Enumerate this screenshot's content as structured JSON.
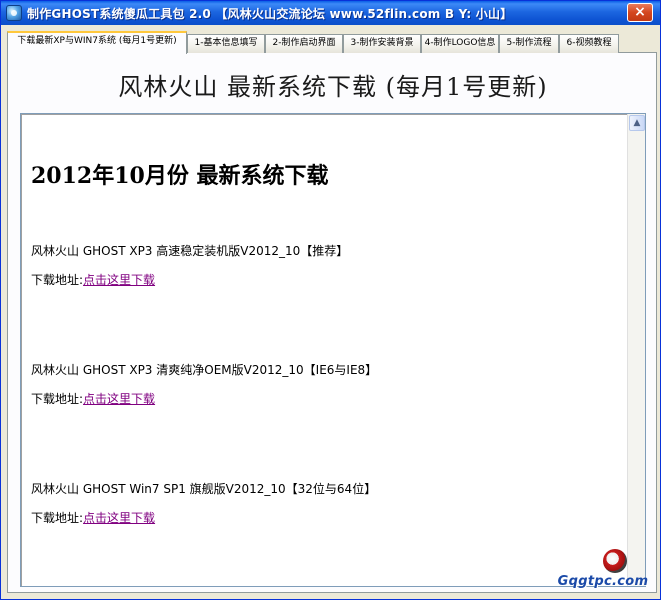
{
  "window": {
    "title": "制作GHOST系统傻瓜工具包 2.0  【风林火山交流论坛 www.52flin.com  B Y: 小山】",
    "close_label": "×"
  },
  "tabs": [
    {
      "label": "下载最新XP与WIN7系统 (每月1号更新)",
      "active": true
    },
    {
      "label": "1-基本信息填写",
      "active": false
    },
    {
      "label": "2-制作启动界面",
      "active": false
    },
    {
      "label": "3-制作安装背景",
      "active": false
    },
    {
      "label": "4-制作LOGO信息",
      "active": false
    },
    {
      "label": "5-制作流程",
      "active": false
    },
    {
      "label": "6-视频教程",
      "active": false
    }
  ],
  "panel": {
    "heading": "风林火山 最新系统下载 (每月1号更新)"
  },
  "browser": {
    "doc_title": "2012年10月份 最新系统下载",
    "entries": [
      {
        "name": "风林火山 GHOST XP3 高速稳定装机版V2012_10【推荐】",
        "dl_label": "下载地址:",
        "link_text": "点击这里下载"
      },
      {
        "name": "风林火山 GHOST XP3 清爽纯净OEM版V2012_10【IE6与IE8】",
        "dl_label": "下载地址:",
        "link_text": "点击这里下载"
      },
      {
        "name": "风林火山 GHOST Win7 SP1 旗舰版V2012_10【32位与64位】",
        "dl_label": "下载地址:",
        "link_text": "点击这里下载"
      }
    ],
    "scroll_up_glyph": "▲"
  },
  "watermark": {
    "text": "Gqgtpc.com"
  }
}
